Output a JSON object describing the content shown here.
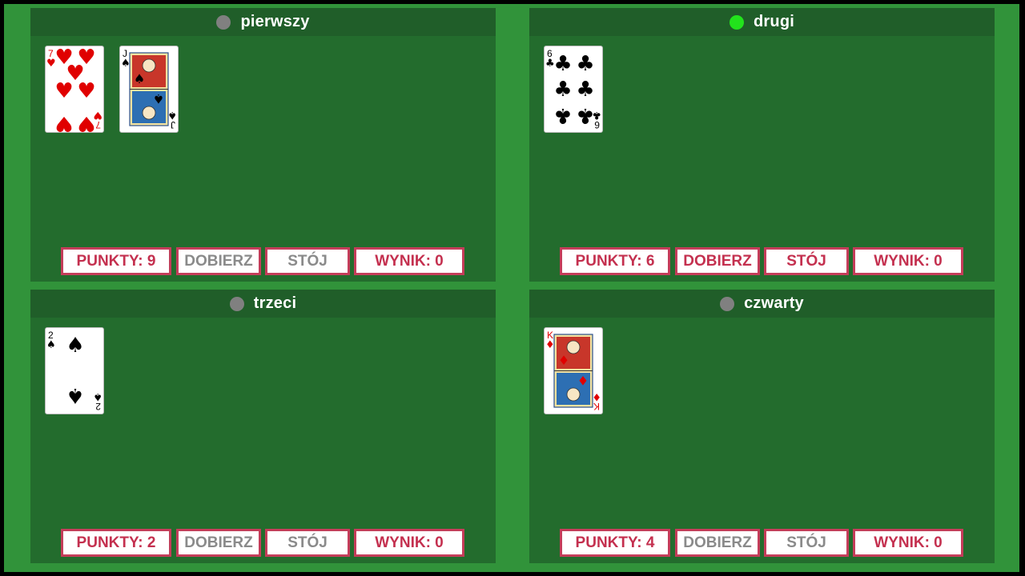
{
  "players": [
    {
      "name": "pierwszy",
      "active": false,
      "points_label": "PUNKTY: 9",
      "draw_label": "DOBIERZ",
      "stand_label": "STÓJ",
      "result_label": "WYNIK: 0",
      "buttons_enabled": false,
      "cards": [
        {
          "rank": "7",
          "suit": "hearts"
        },
        {
          "rank": "J",
          "suit": "spades"
        }
      ]
    },
    {
      "name": "drugi",
      "active": true,
      "points_label": "PUNKTY: 6",
      "draw_label": "DOBIERZ",
      "stand_label": "STÓJ",
      "result_label": "WYNIK: 0",
      "buttons_enabled": true,
      "cards": [
        {
          "rank": "6",
          "suit": "clubs"
        }
      ]
    },
    {
      "name": "trzeci",
      "active": false,
      "points_label": "PUNKTY: 2",
      "draw_label": "DOBIERZ",
      "stand_label": "STÓJ",
      "result_label": "WYNIK: 0",
      "buttons_enabled": false,
      "cards": [
        {
          "rank": "2",
          "suit": "spades"
        }
      ]
    },
    {
      "name": "czwarty",
      "active": false,
      "points_label": "PUNKTY: 4",
      "draw_label": "DOBIERZ",
      "stand_label": "STÓJ",
      "result_label": "WYNIK: 0",
      "buttons_enabled": false,
      "cards": [
        {
          "rank": "K",
          "suit": "diamonds"
        }
      ]
    }
  ],
  "colors": {
    "table": "#31933a",
    "panel": "#236c2d",
    "header": "#205e29",
    "active_dot": "#22e31c",
    "inactive_dot": "#808080",
    "button_border": "#c43d5a",
    "button_text": "#c4304f",
    "button_disabled_text": "#8a8a8a"
  }
}
